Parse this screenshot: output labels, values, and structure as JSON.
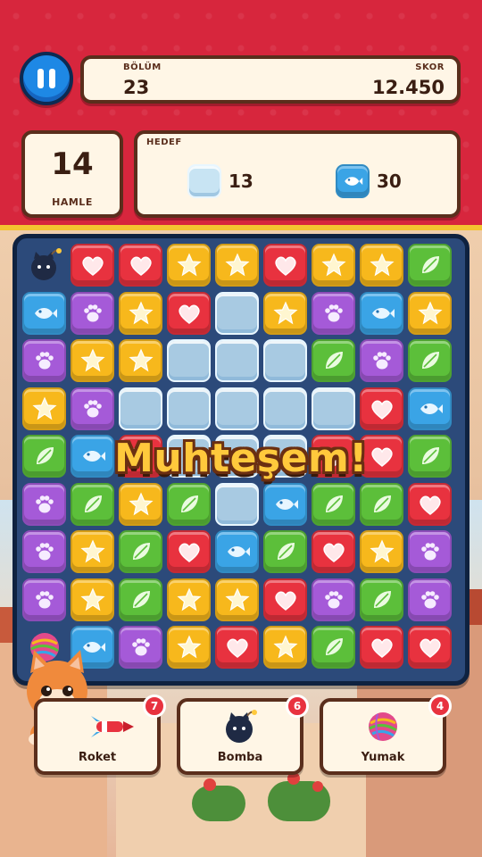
{
  "header": {
    "level_label": "BÖLÜM",
    "level": "23",
    "score_label": "SKOR",
    "score": "12.450",
    "moves": "14",
    "moves_label": "HAMLE",
    "goal_label": "HEDEF",
    "goals": [
      {
        "icon": "ice-cube-icon",
        "count": "13"
      },
      {
        "icon": "fish-tile-icon",
        "count": "30"
      }
    ]
  },
  "board": {
    "rows": [
      [
        "bomb",
        "heart",
        "heart",
        "star",
        "star",
        "heart",
        "star",
        "star",
        "leaf"
      ],
      [
        "fish",
        "paw",
        "star",
        "heart",
        "ice",
        "star",
        "paw",
        "fish",
        "star"
      ],
      [
        "paw",
        "star",
        "star",
        "ice",
        "ice",
        "ice",
        "leaf",
        "paw",
        "leaf"
      ],
      [
        "star",
        "paw",
        "ice",
        "ice",
        "ice",
        "ice",
        "ice",
        "heart",
        "fish"
      ],
      [
        "leaf",
        "fish",
        "heart",
        "ice",
        "ice",
        "ice",
        "heart",
        "heart",
        "leaf"
      ],
      [
        "paw",
        "leaf",
        "star",
        "leaf",
        "ice",
        "fish",
        "leaf",
        "leaf",
        "heart"
      ],
      [
        "paw",
        "star",
        "leaf",
        "heart",
        "fish",
        "leaf",
        "heart",
        "star",
        "paw"
      ],
      [
        "paw",
        "star",
        "leaf",
        "star",
        "star",
        "heart",
        "paw",
        "leaf",
        "paw"
      ],
      [
        "yarn",
        "fish",
        "paw",
        "star",
        "heart",
        "star",
        "leaf",
        "heart",
        "heart"
      ]
    ]
  },
  "combo_text": "Muhteşem!",
  "boosters": [
    {
      "label": "Roket",
      "count": "7",
      "icon": "rocket-icon"
    },
    {
      "label": "Bomba",
      "count": "6",
      "icon": "bomb-icon"
    },
    {
      "label": "Yumak",
      "count": "4",
      "icon": "yarn-ball-icon"
    }
  ],
  "colors": {
    "header_red": "#d7263d",
    "heart": "#e8323f",
    "star": "#f7b81c",
    "leaf": "#5cbf3a",
    "paw": "#a55ad8",
    "fish": "#3aa4e6"
  }
}
